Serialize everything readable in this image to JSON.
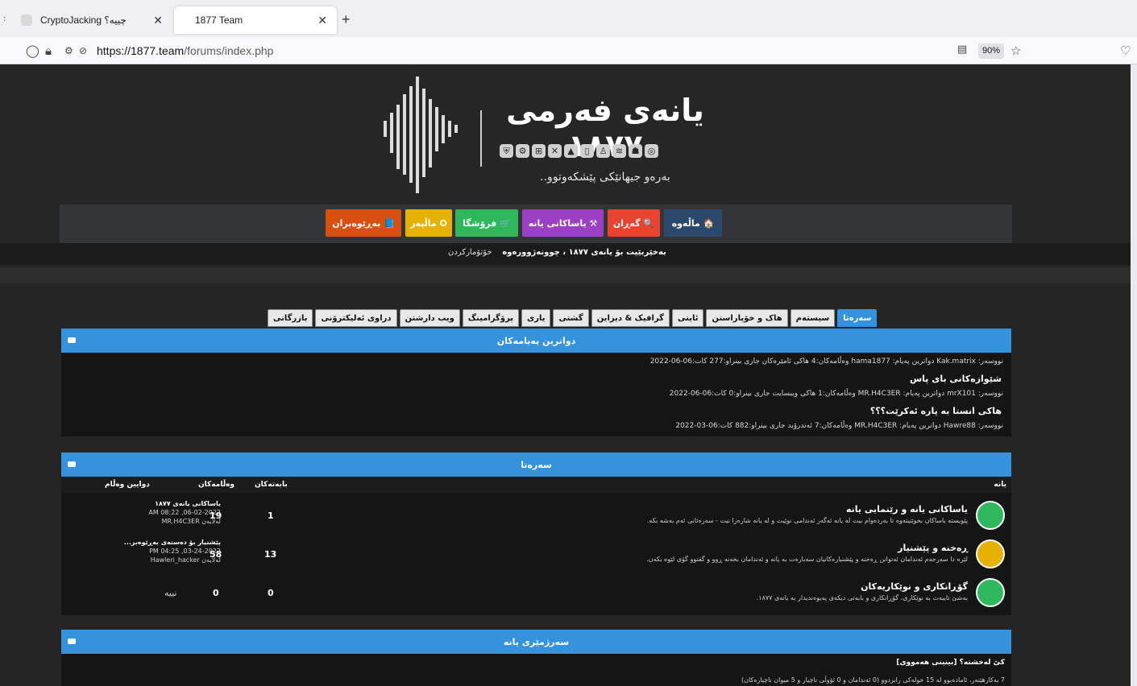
{
  "browser": {
    "tabs": [
      {
        "label": "CryptoJacking چییە؟"
      },
      {
        "label": "1877 Team"
      }
    ],
    "url_host": "https://1877.team",
    "url_path": "/forums/index.php",
    "zoom": "90%"
  },
  "site": {
    "logo_title": "یانەی فەرمی ١٨٧٧",
    "logo_subtitle": "بەرەو جیهانێکی پێشکەوتوو..",
    "nav": [
      {
        "label": "🏠 ماڵەوە",
        "color": "#2b4a6b"
      },
      {
        "label": "🔍 گەڕان",
        "color": "#e8442f"
      },
      {
        "label": "⚒ یاساکانی یانە",
        "color": "#9b3fc4"
      },
      {
        "label": "🛒 فرۆشگا",
        "color": "#2eb85c"
      },
      {
        "label": "✪ ماڵپەر",
        "color": "#e7b100"
      },
      {
        "label": "📘 بەڕێوەبران",
        "color": "#d84f10"
      }
    ],
    "breadcrumb_welcome": "بەخێربێیت بۆ یانەی ١٨٧٧ ، چوونەژوورەوە",
    "breadcrumb_register": "خۆتۆمارکردن",
    "forum_tabs": [
      "سەرەتا",
      "سیستەم",
      "هاک و خۆپاراستن",
      "ئایتی",
      "گرافیک & دیزاین",
      "گشتی",
      "یاری",
      "پرۆگرامینگ",
      "ویب دارشتن",
      "دراوی ئەلیکترۆنی",
      "بازرگانی"
    ]
  },
  "recent_posts": {
    "header": "دواترین پەیامەکان",
    "rows": [
      {
        "meta": "نووسەر: Kak.matrix دواترین پەیام: hama1877 وەڵامەکان:4 هاکی ئامێرەکان جاری بینراو:277 کات:06-06-2022"
      },
      {
        "title": "شێوازەکانی بای پاس"
      },
      {
        "meta": "نووسەر: mrX101 دواترین پەیام: MR.H4C3ER وەڵامەکان:1 هاکی ویبسایت جاری بینراو:0 کات:06-06-2022"
      },
      {
        "title": "هاکی انستا بە پارە ئەکرێت؟؟؟"
      },
      {
        "meta": "نووسەر: Hawre88 دواترین پەیام: MR.H4C3ER وەڵامەکان:7 ئەندرۆید جاری بینراو:882 کات:06-03-2022"
      }
    ]
  },
  "forums": {
    "header": "سەرەتا",
    "col_forum": "یانە",
    "col_threads": "بابەتەکان",
    "col_replies": "وەڵامەکان",
    "col_last": "دوایین وەڵام",
    "rows": [
      {
        "title": "یاساکانی یانە و رێنمایی یانە",
        "desc": "پێویستە یاساکان بخوێنیتەوە تا بەردەوام بیت لە یانە ئەگەر ئەندامی نوێیت و لە یانە شارەزا نیت - سەرەتانی ئەم بەشە بکە.",
        "threads": "1",
        "replies": "19",
        "last_title": "یاساکانی یانەی ١٨٧٧",
        "last_date": "06-02-2022, 08:22 AM",
        "last_by": "لەلایەن MR.H4C3ER",
        "icon_color": "#2eb85c"
      },
      {
        "title": "ڕەخنە و پێشنیار",
        "desc": "لێرە دا سەرجەم ئەندامان ئەتوانن ڕەخنە و پێشنیارەکانیان سەبارەت بە یانە و ئەندامان بخەنە ڕوو و گفتوو گۆی لێوە بکەن.",
        "threads": "13",
        "replies": "58",
        "last_title": "پێشنیار بۆ دەستەی بەڕێوەبر...",
        "last_date": "03-24-2022, 04:25 PM",
        "last_by": "لەلایەن Hawleri_hacker",
        "icon_color": "#e7b100"
      },
      {
        "title": "گۆڕانکاری و نوێکاریەکان",
        "desc": "بەشێ تایبەت بە نوێکاری، گۆڕانکاری و بابەتی دیکەی پەیوەندیدار بە یانەی ١٨٧٧.",
        "threads": "0",
        "replies": "0",
        "last_none": "نییە",
        "icon_color": "#2eb85c"
      }
    ]
  },
  "stats": {
    "header": "سەرژمێری یانە",
    "online_title": "کێ لەخشتە؟ [بینینی هەمووی]",
    "online_line": "7 بەکارهێنەر، ئامادەبوو لە 15 خولەکی رابردوو (0 ئەندامان و 0 ئۆوڵی ناچیار و 5 میوان ناچیارەکان)"
  }
}
